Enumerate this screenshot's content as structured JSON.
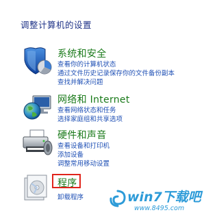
{
  "page": {
    "title": "调整计算机的设置"
  },
  "categories": [
    {
      "id": "system-security",
      "icon": "shield-icon",
      "title": "系统和安全",
      "links": [
        "查看你的计算机状态",
        "通过文件历史记录保存你的文件备份副本",
        "查找并解决问题"
      ]
    },
    {
      "id": "network-internet",
      "icon": "globe-network-icon",
      "title": "网络和 Internet",
      "links": [
        "查看网络状态和任务",
        "选择家庭组和共享选项"
      ]
    },
    {
      "id": "hardware-sound",
      "icon": "printer-icon",
      "title": "硬件和声音",
      "links": [
        "查看设备和打印机",
        "添加设备",
        "调整常用移动设置"
      ]
    },
    {
      "id": "programs",
      "icon": "programs-icon",
      "title": "程序",
      "links": [
        "卸载程序"
      ]
    }
  ],
  "watermark": {
    "brand": "win7下载吧",
    "url": "www.8495.com",
    "color": "#2d9bd8"
  },
  "colors": {
    "title": "#1e3287",
    "category": "#1a7a1a",
    "link": "#1f50b5",
    "highlight": "#e0241b"
  }
}
